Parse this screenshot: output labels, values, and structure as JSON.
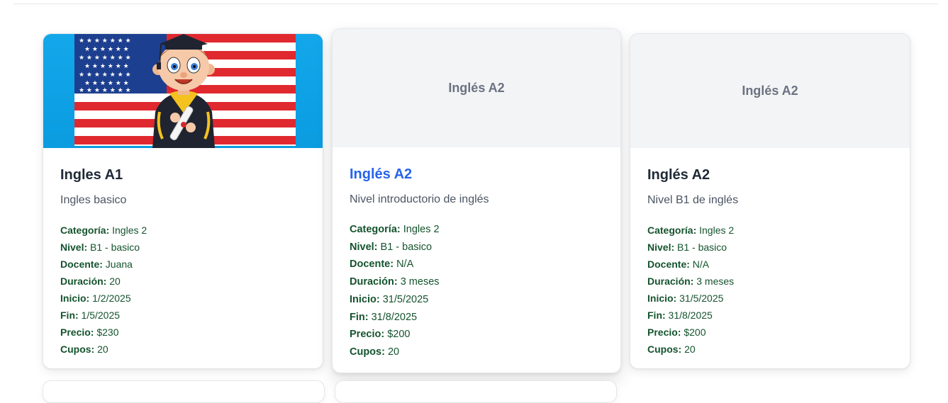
{
  "courses": [
    {
      "title": "Ingles A1",
      "description": "Ingles basico",
      "image": "flag-graduate-illustration",
      "labels": [
        "Categoría:",
        "Nivel:",
        "Docente:",
        "Duración:",
        "Inicio:",
        "Fin:",
        "Precio:",
        "Cupos:"
      ],
      "values": [
        "Ingles 2",
        "B1 - basico",
        "Juana",
        "20",
        "1/2/2025",
        "1/5/2025",
        "$230",
        "20"
      ]
    },
    {
      "title": "Inglés A2",
      "placeholder": "Inglés A2",
      "description": "Nivel introductorio de inglés",
      "labels": [
        "Categoría:",
        "Nivel:",
        "Docente:",
        "Duración:",
        "Inicio:",
        "Fin:",
        "Precio:",
        "Cupos:"
      ],
      "values": [
        "Ingles 2",
        "B1 - basico",
        "N/A",
        "3 meses",
        "31/5/2025",
        "31/8/2025",
        "$200",
        "20"
      ]
    },
    {
      "title": "Inglés A2",
      "placeholder": "Inglés A2",
      "description": "Nivel B1 de inglés",
      "labels": [
        "Categoría:",
        "Nivel:",
        "Docente:",
        "Duración:",
        "Inicio:",
        "Fin:",
        "Precio:",
        "Cupos:"
      ],
      "values": [
        "Ingles 2",
        "B1 - basico",
        "N/A",
        "3 meses",
        "31/5/2025",
        "31/8/2025",
        "$200",
        "20"
      ]
    }
  ],
  "colors": {
    "title_default": "#1f2937",
    "title_hover": "#2563eb",
    "meta_label": "#14532d",
    "placeholder_bg": "#f3f4f6"
  }
}
